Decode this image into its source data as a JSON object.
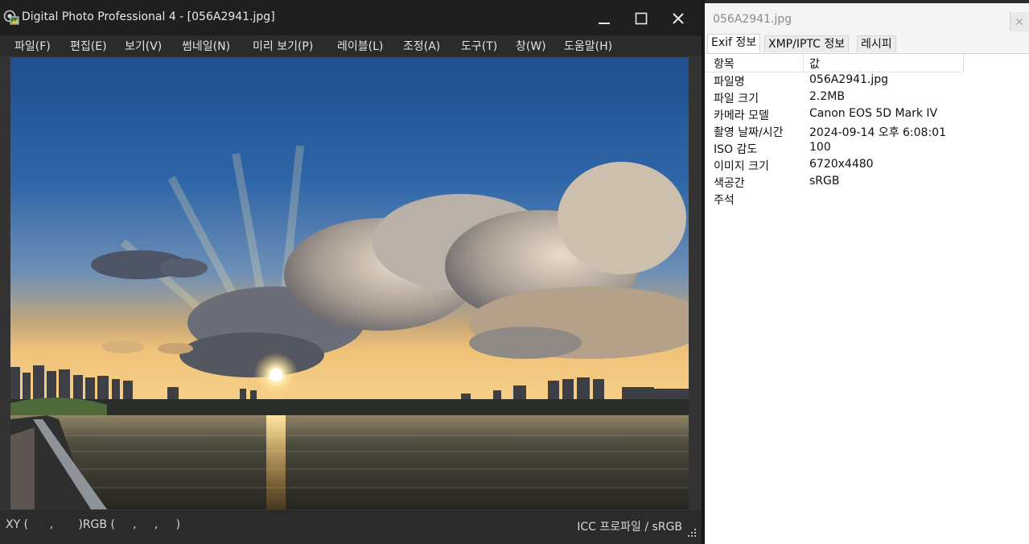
{
  "window": {
    "title": "Digital Photo Professional 4 - [056A2941.jpg]",
    "minimize_icon": "minimize-icon",
    "maximize_icon": "maximize-icon",
    "close_icon": "close-icon"
  },
  "menu": {
    "items": [
      {
        "label": "파일(F)"
      },
      {
        "label": "편집(E)"
      },
      {
        "label": "보기(V)"
      },
      {
        "label": "썸네일(N)"
      },
      {
        "label": "미리 보기(P)"
      },
      {
        "label": "레이블(L)"
      },
      {
        "label": "조정(A)"
      },
      {
        "label": "도구(T)"
      },
      {
        "label": "창(W)"
      },
      {
        "label": "도움말(H)"
      }
    ]
  },
  "status": {
    "readout": "XY (      ,       )RGB (     ,     ,     )",
    "icc": "ICC 프로파일 / sRGB"
  },
  "info_panel": {
    "filename": "056A2941.jpg",
    "tabs": [
      {
        "label": "Exif 정보",
        "active": true
      },
      {
        "label": "XMP/IPTC 정보",
        "active": false
      },
      {
        "label": "레시피",
        "active": false
      }
    ],
    "columns": {
      "key": "항목",
      "value": "값"
    },
    "rows": [
      {
        "key": "파일명",
        "value": "056A2941.jpg"
      },
      {
        "key": "파일 크기",
        "value": "2.2MB"
      },
      {
        "key": "카메라 모델",
        "value": "Canon EOS 5D Mark IV"
      },
      {
        "key": "촬영 날짜/시간",
        "value": "2024-09-14 오후 6:08:01"
      },
      {
        "key": "ISO 감도",
        "value": "100"
      },
      {
        "key": "이미지 크기",
        "value": "6720x4480"
      },
      {
        "key": "색공간",
        "value": "sRGB"
      },
      {
        "key": "주석",
        "value": ""
      }
    ]
  },
  "colors": {
    "window_bg": "#2b2b2b",
    "titlebar_bg": "#1f1f1f",
    "panel_bg": "#ffffff",
    "text_light": "#e8e8e8"
  }
}
